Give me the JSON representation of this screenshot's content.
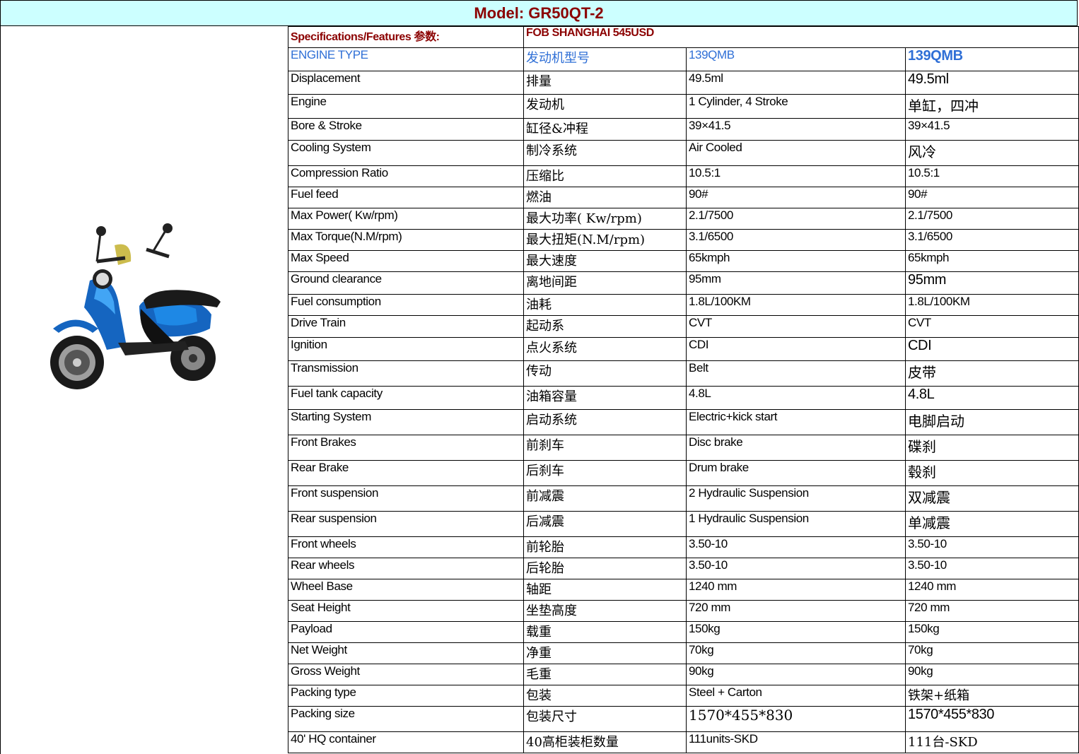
{
  "header": {
    "title": "Model: GR50QT-2"
  },
  "price_row": {
    "label": "Specifications/Features 参数:",
    "value": "FOB SHANGHAI 545USD"
  },
  "engine_type": {
    "en": "ENGINE TYPE",
    "cn": "发动机型号",
    "v1": "139QMB",
    "v2": "139QMB"
  },
  "rows": [
    {
      "en": "Displacement",
      "cn": "排量",
      "v1": "49.5ml",
      "v2": "49.5ml"
    },
    {
      "en": "Engine",
      "cn": "发动机",
      "v1": "1 Cylinder, 4 Stroke",
      "v2": "单缸，四冲"
    },
    {
      "en": "Bore & Stroke",
      "cn": "缸径&冲程",
      "v1": "39×41.5",
      "v2": "39×41.5"
    },
    {
      "en": "Cooling System",
      "cn": "制冷系统",
      "v1": "Air Cooled",
      "v2": "风冷"
    },
    {
      "en": "Compression Ratio",
      "cn": "压缩比",
      "v1": "10.5:1",
      "v2": "10.5:1"
    },
    {
      "en": "Fuel feed",
      "cn": "燃油",
      "v1": "90#",
      "v2": "90#"
    },
    {
      "en": "Max Power( Kw/rpm)",
      "cn": "最大功率( Kw/rpm)",
      "v1": "2.1/7500",
      "v2": "2.1/7500"
    },
    {
      "en": "Max Torque(N.M/rpm)",
      "cn": "最大扭矩(N.M/rpm)",
      "v1": "3.1/6500",
      "v2": "3.1/6500"
    },
    {
      "en": "Max Speed",
      "cn": "最大速度",
      "v1": "65kmph",
      "v2": "65kmph"
    },
    {
      "en": "Ground clearance",
      "cn": "离地间距",
      "v1": "95mm",
      "v2": "95mm"
    },
    {
      "en": "Fuel consumption",
      "cn": "油耗",
      "v1": "1.8L/100KM",
      "v2": "1.8L/100KM"
    },
    {
      "en": "Drive Train",
      "cn": "起动系",
      "v1": "CVT",
      "v2": "CVT"
    },
    {
      "en": "Ignition",
      "cn": "点火系统",
      "v1": "CDI",
      "v2": "CDI"
    },
    {
      "en": "Transmission",
      "cn": "传动",
      "v1": "Belt",
      "v2": "皮带"
    },
    {
      "en": "Fuel tank capacity",
      "cn": "油箱容量",
      "v1": "4.8L",
      "v2": "4.8L"
    },
    {
      "en": "Starting System",
      "cn": "启动系统",
      "v1": "Electric+kick start",
      "v2": "电脚启动"
    },
    {
      "en": "Front Brakes",
      "cn": "前刹车",
      "v1": "Disc brake",
      "v2": "碟刹"
    },
    {
      "en": "Rear Brake",
      "cn": "后刹车",
      "v1": "Drum brake",
      "v2": "毂刹"
    },
    {
      "en": "Front suspension",
      "cn": "前减震",
      "v1": "2 Hydraulic Suspension",
      "v2": "双减震"
    },
    {
      "en": "Rear suspension",
      "cn": "后减震",
      "v1": "1 Hydraulic Suspension",
      "v2": "单减震"
    },
    {
      "en": "Front wheels",
      "cn": "前轮胎",
      "v1": "3.50-10",
      "v2": "3.50-10"
    },
    {
      "en": "Rear wheels",
      "cn": "后轮胎",
      "v1": "3.50-10",
      "v2": "3.50-10"
    },
    {
      "en": "Wheel Base",
      "cn": "轴距",
      "v1": "1240 mm",
      "v2": "1240 mm"
    },
    {
      "en": "Seat Height",
      "cn": "坐垫高度",
      "v1": "720 mm",
      "v2": "720 mm"
    },
    {
      "en": "Payload",
      "cn": "载重",
      "v1": "150kg",
      "v2": "150kg"
    },
    {
      "en": "Net Weight",
      "cn": "净重",
      "v1": "70kg",
      "v2": "70kg"
    },
    {
      "en": "Gross Weight",
      "cn": "毛重",
      "v1": "90kg",
      "v2": "90kg"
    },
    {
      "en": "Packing type",
      "cn": "包装",
      "v1": "Steel + Carton",
      "v2": "铁架+纸箱"
    },
    {
      "en": "Packing size",
      "cn": "包装尺寸",
      "v1": "1570*455*830",
      "v2": "1570*455*830"
    },
    {
      "en": "40' HQ container",
      "cn": "40高柜装柜数量",
      "v1": "111units-SKD",
      "v2": "111台-SKD"
    }
  ],
  "colors": {
    "header_bg": "#ccffff",
    "title": "#8b0000",
    "engine_type": "#2f6fd6",
    "scooter_body": "#1565c0"
  }
}
